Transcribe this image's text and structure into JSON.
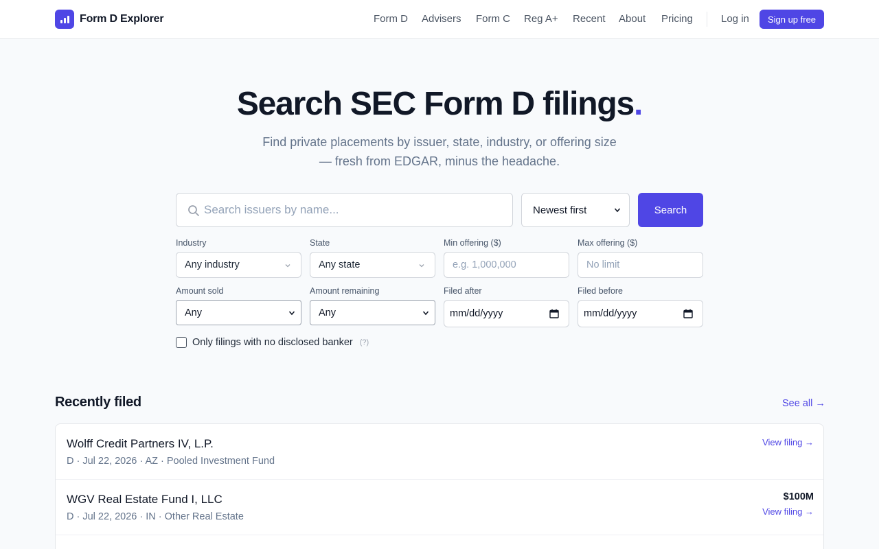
{
  "app": {
    "name": "Form D Explorer",
    "logo_icon": "bar-chart-icon",
    "accent": "#4f46e5"
  },
  "nav": {
    "links": [
      "Form D",
      "Advisers",
      "Form C",
      "Reg A+",
      "Recent",
      "About",
      "Pricing"
    ],
    "login": "Log in",
    "signup": "Sign up free"
  },
  "hero": {
    "title": "Search SEC Form D filings",
    "title_dot": ".",
    "subtitle_line1": "Find private placements by issuer, state, industry, or offering size",
    "subtitle_line2": "— fresh from EDGAR, minus the headache."
  },
  "search": {
    "placeholder": "Search issuers by name...",
    "sort_value": "Newest first",
    "button": "Search"
  },
  "filters": {
    "industry": {
      "label": "Industry",
      "value": "Any industry"
    },
    "state": {
      "label": "State",
      "value": "Any state"
    },
    "min_offering": {
      "label": "Min offering ($)",
      "placeholder": "e.g. 1,000,000"
    },
    "max_offering": {
      "label": "Max offering ($)",
      "placeholder": "No limit"
    },
    "amount_sold": {
      "label": "Amount sold",
      "value": "Any"
    },
    "amount_remaining": {
      "label": "Amount remaining",
      "value": "Any"
    },
    "filed_after": {
      "label": "Filed after",
      "value": "mm/dd/yyyy"
    },
    "filed_before": {
      "label": "Filed before",
      "value": "mm/dd/yyyy"
    },
    "no_banker": {
      "label": "Only filings with no disclosed banker",
      "help": "(?)",
      "checked": false
    }
  },
  "recent": {
    "title": "Recently filed",
    "see_all": "See all →",
    "items": [
      {
        "name": "Wolff Credit Partners IV, L.P.",
        "meta": "D · Jul 22, 2026 · AZ · Pooled Investment Fund",
        "amount": "",
        "link": "View filing →"
      },
      {
        "name": "WGV Real Estate Fund I, LLC",
        "meta": "D · Jul 22, 2026 · IN · Other Real Estate",
        "amount": "$100M",
        "link": "View filing →"
      }
    ]
  }
}
